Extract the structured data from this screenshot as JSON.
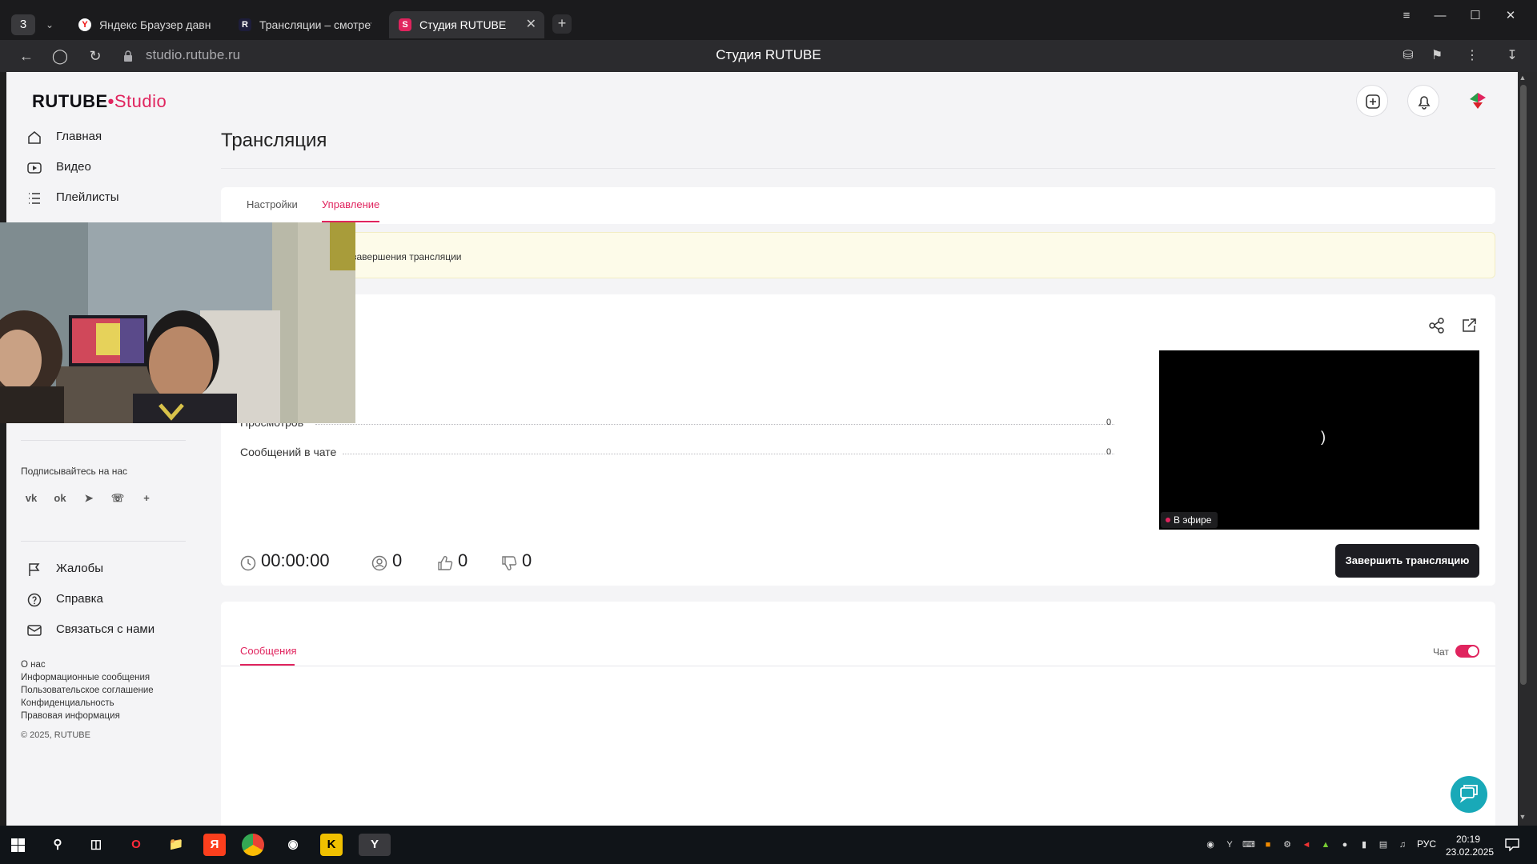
{
  "browser": {
    "tab_count": "3",
    "tabs": [
      {
        "label": "Яндекс Браузер давно не",
        "favicon": "Y"
      },
      {
        "label": "Трансляции – смотреть в",
        "favicon": "R"
      },
      {
        "label": "Студия RUTUBE",
        "favicon": "S"
      }
    ],
    "url": "studio.rutube.ru",
    "page_title": "Студия RUTUBE",
    "colors": {
      "accent": "#e0245e",
      "chrome": "#2b2b2e"
    }
  },
  "logo": {
    "brand": "RUTUBE",
    "suffix": "Studio"
  },
  "sidebar": {
    "items": [
      {
        "label": "Главная",
        "icon": "home-icon"
      },
      {
        "label": "Видео",
        "icon": "video-icon"
      },
      {
        "label": "Плейлисты",
        "icon": "list-icon"
      }
    ],
    "follow_title": "Подписывайтесь на нас",
    "socials": [
      "vk-icon",
      "ok-icon",
      "telegram-icon",
      "viber-icon",
      "plus-icon"
    ],
    "support_items": [
      {
        "label": "Жалобы",
        "icon": "flag-icon"
      },
      {
        "label": "Справка",
        "icon": "help-icon"
      },
      {
        "label": "Связаться с нами",
        "icon": "mail-icon"
      }
    ],
    "footer_links": [
      "О нас",
      "Информационные сообщения",
      "Пользовательское соглашение",
      "Конфиденциальность",
      "Правовая информация"
    ],
    "copyright": "© 2025, RUTUBE"
  },
  "main": {
    "title": "Трансляция",
    "tabs": [
      "Настройки",
      "Управление"
    ],
    "notice": "завершения трансляции",
    "stats": [
      {
        "label": "Просмотров",
        "value": "0"
      },
      {
        "label": "Сообщений в чате",
        "value": "0"
      }
    ],
    "metrics": {
      "duration": "00:00:00",
      "viewers": "0",
      "likes": "0",
      "dislikes": "0"
    },
    "live_badge": "В эфире",
    "end_button": "Завершить трансляцию",
    "messages_tab": "Сообщения",
    "chat_label": "Чат",
    "chat_enabled": true
  },
  "taskbar": {
    "language": "РУС",
    "time": "20:19",
    "date": "23.02.2025"
  }
}
